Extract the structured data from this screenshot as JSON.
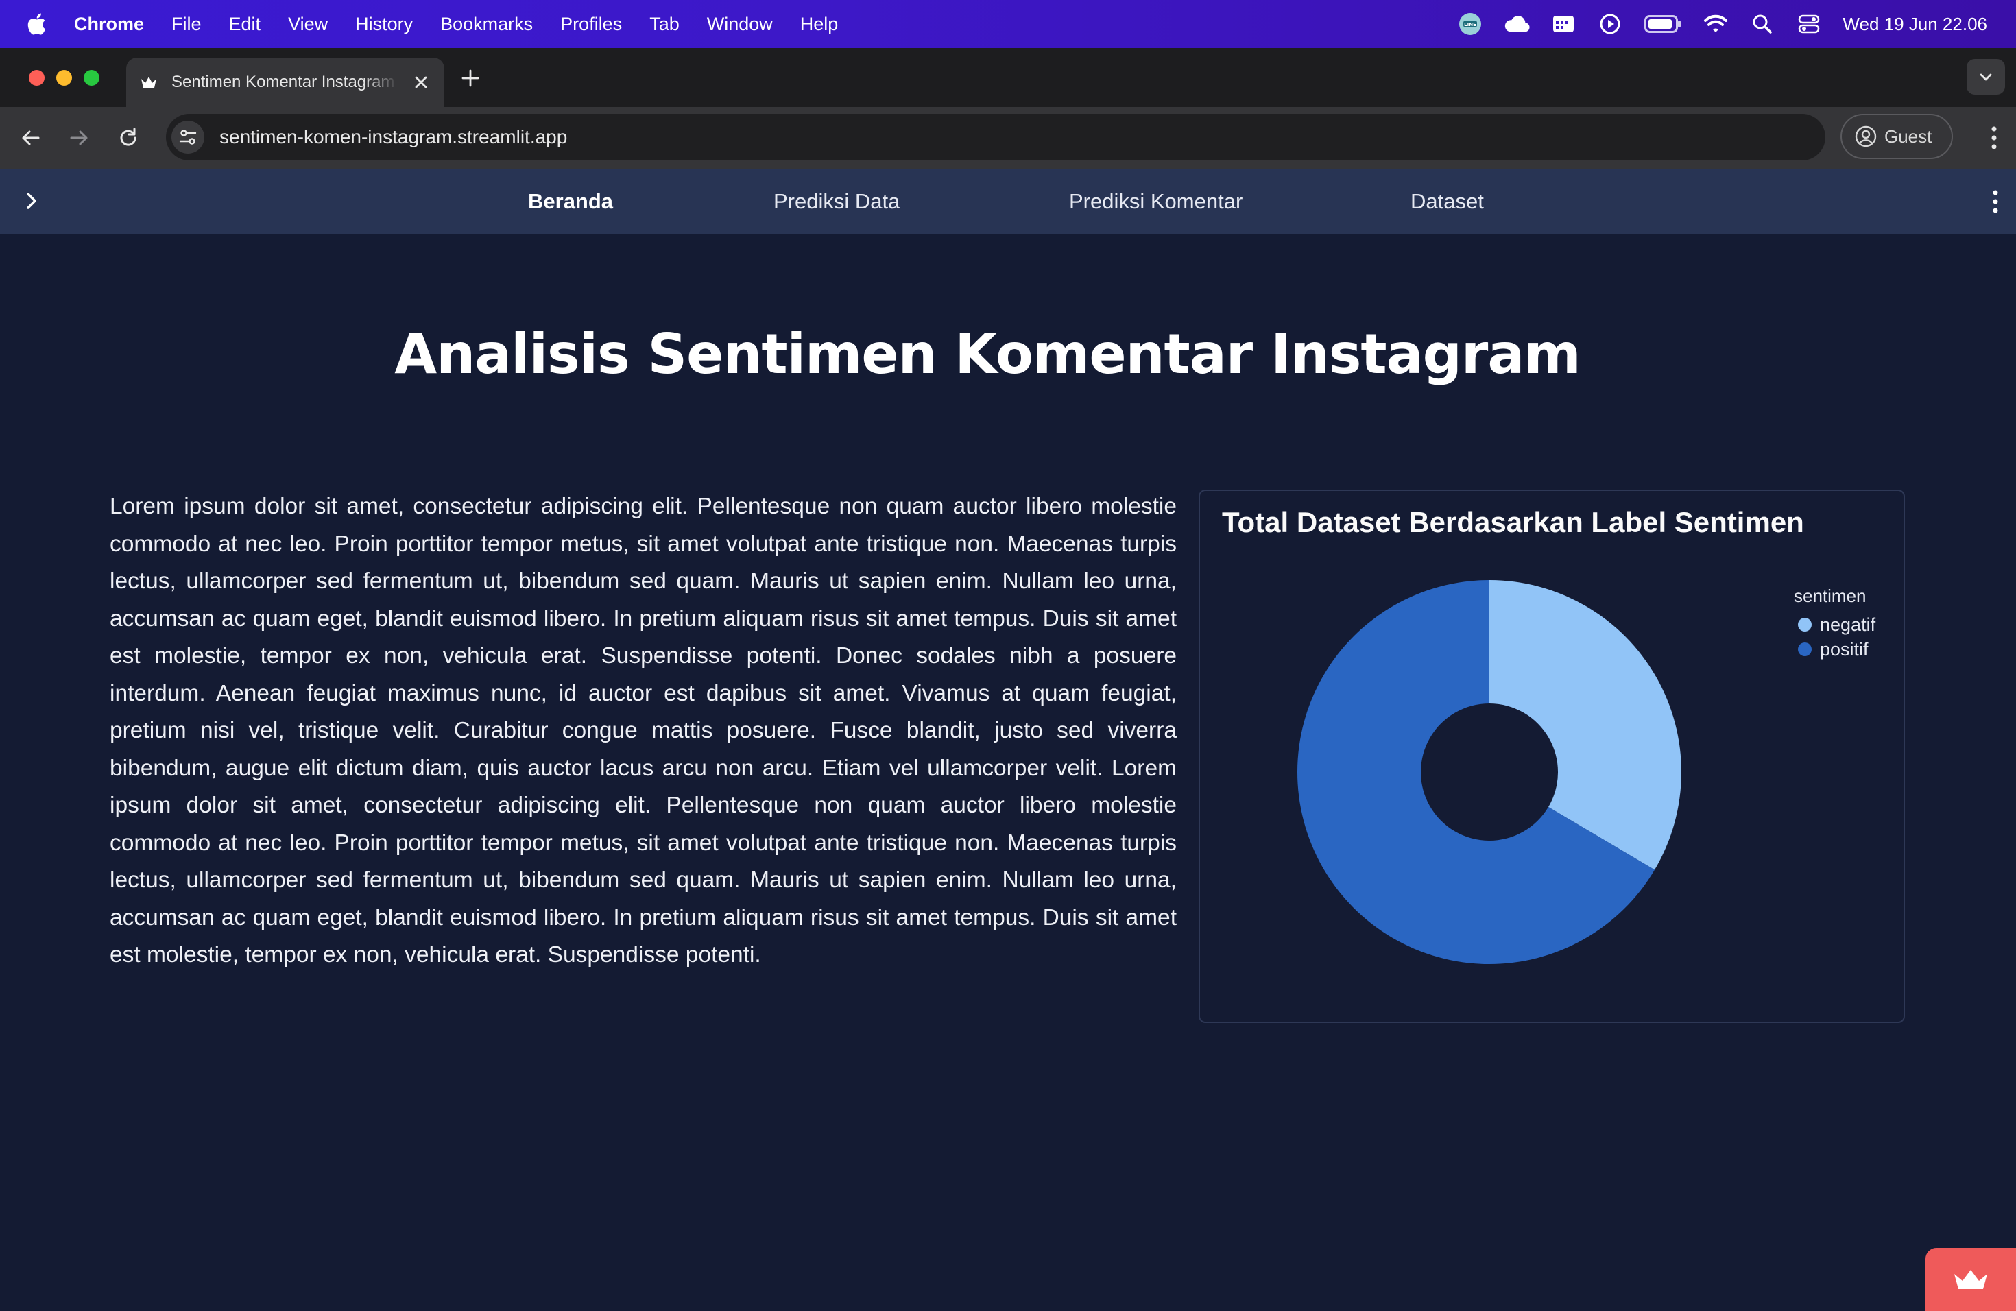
{
  "menubar": {
    "app_name": "Chrome",
    "items": [
      "File",
      "Edit",
      "View",
      "History",
      "Bookmarks",
      "Profiles",
      "Tab",
      "Window",
      "Help"
    ],
    "clock": "Wed 19 Jun  22.06",
    "status_icons": [
      "line-icon",
      "cloud-icon",
      "calendar-icon",
      "play-icon",
      "battery-icon",
      "wifi-icon",
      "search-icon",
      "control-center-icon"
    ]
  },
  "browser": {
    "tab_title": "Sentimen Komentar Instagram",
    "url": "sentimen-komen-instagram.streamlit.app",
    "profile_label": "Guest"
  },
  "app_nav": {
    "links": [
      {
        "label": "Beranda",
        "active": true
      },
      {
        "label": "Prediksi Data",
        "active": false
      },
      {
        "label": "Prediksi Komentar",
        "active": false
      },
      {
        "label": "Dataset",
        "active": false
      }
    ]
  },
  "main": {
    "title": "Analisis Sentimen Komentar Instagram",
    "paragraph": "Lorem ipsum dolor sit amet, consectetur adipiscing elit. Pellentesque non quam auctor libero molestie commodo at nec leo. Proin porttitor tempor metus, sit amet volutpat ante tristique non. Maecenas turpis lectus, ullamcorper sed fermentum ut, bibendum sed quam. Mauris ut sapien enim. Nullam leo urna, accumsan ac quam eget, blandit euismod libero. In pretium aliquam risus sit amet tempus. Duis sit amet est molestie, tempor ex non, vehicula erat. Suspendisse potenti. Donec sodales nibh a posuere interdum. Aenean feugiat maximus nunc, id auctor est dapibus sit amet. Vivamus at quam feugiat, pretium nisi vel, tristique velit. Curabitur congue mattis posuere. Fusce blandit, justo sed viverra bibendum, augue elit dictum diam, quis auctor lacus arcu non arcu. Etiam vel ullamcorper velit. Lorem ipsum dolor sit amet, consectetur adipiscing elit. Pellentesque non quam auctor libero molestie commodo at nec leo. Proin porttitor tempor metus, sit amet volutpat ante tristique non. Maecenas turpis lectus, ullamcorper sed fermentum ut, bibendum sed quam. Mauris ut sapien enim. Nullam leo urna, accumsan ac quam eget, blandit euismod libero. In pretium aliquam risus sit amet tempus. Duis sit amet est molestie, tempor ex non, vehicula erat. Suspendisse potenti."
  },
  "chart_data": {
    "type": "pie",
    "title": "Total Dataset Berdasarkan Label Sentimen",
    "legend_title": "sentimen",
    "legend_position": "top-right",
    "donut": true,
    "categories": [
      "negatif",
      "positif"
    ],
    "values": [
      33.5,
      66.5
    ],
    "colors": [
      "#91c4f7",
      "#2a66c2"
    ]
  },
  "colors": {
    "background": "#141b33",
    "nav_background": "#283454",
    "accent_badge": "#ef5a5a"
  }
}
